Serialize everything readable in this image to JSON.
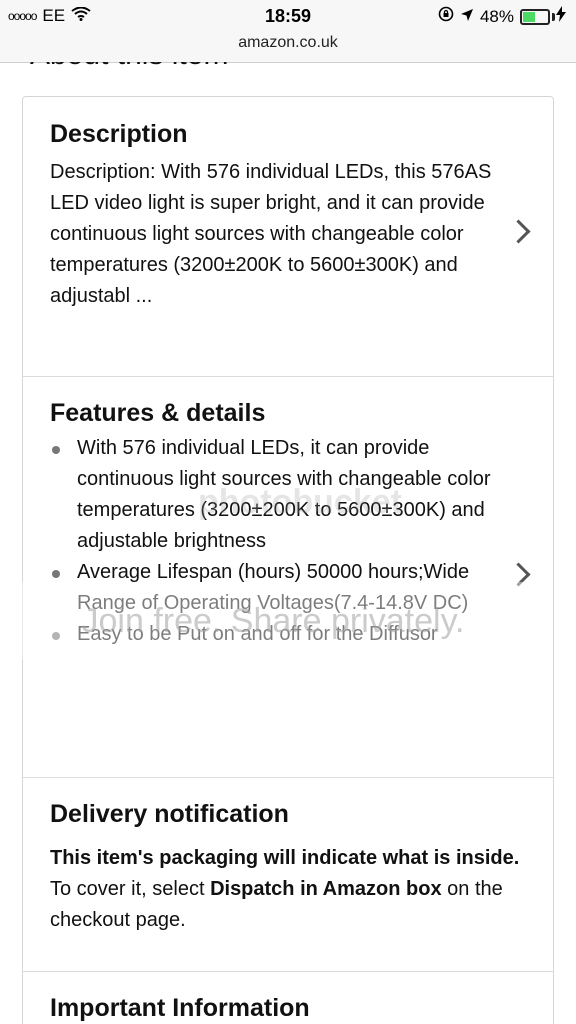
{
  "status": {
    "signal_dots": "ooooo",
    "carrier": "EE",
    "time": "18:59",
    "battery_percent": "48%",
    "battery_level": 0.48
  },
  "browser": {
    "url": "amazon.co.uk"
  },
  "page": {
    "about_title": "About this item",
    "description": {
      "title": "Description",
      "text": "Description: With 576 individual LEDs, this 576AS LED video light is super bright, and it can provide continuous light sources with changeable color temperatures (3200±200K to 5600±300K) and adjustabl ..."
    },
    "features": {
      "title": "Features & details",
      "items": [
        "With 576 individual LEDs, it can provide continuous light sources with changeable color temperatures (3200±200K to 5600±300K) and adjustable brightness",
        "Average Lifespan (hours) 50000 hours;Wide Range of Operating Voltages(7.4-14.8V DC)",
        "Easy to be Put on and off for the Diffusor"
      ]
    },
    "delivery": {
      "title": "Delivery notification",
      "bold1": "This item's packaging will indicate what is inside.",
      "text1": " To cover it, select ",
      "bold2": "Dispatch in Amazon box",
      "text2": " on the checkout page."
    },
    "important": {
      "title": "Important Information"
    }
  },
  "watermark": {
    "logo": "photobucket",
    "text": "Join free. Share privately."
  }
}
